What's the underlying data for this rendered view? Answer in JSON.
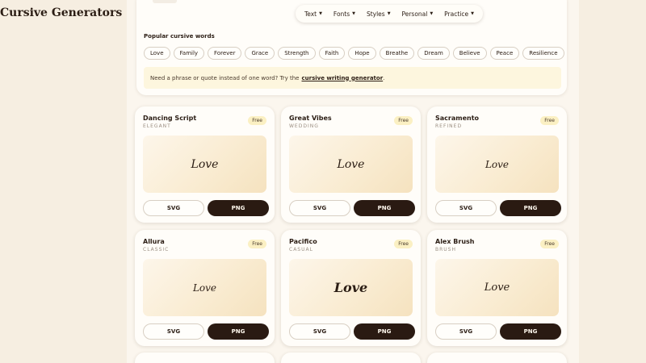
{
  "header": {
    "brand": "Cursive Generators",
    "nav": [
      {
        "label": "Text"
      },
      {
        "label": "Fonts"
      },
      {
        "label": "Styles"
      },
      {
        "label": "Personal"
      },
      {
        "label": "Practice"
      }
    ],
    "caret_glyph": "▼"
  },
  "popular": {
    "title": "Popular cursive words",
    "chips": [
      "Love",
      "Family",
      "Forever",
      "Grace",
      "Strength",
      "Faith",
      "Hope",
      "Breathe",
      "Dream",
      "Believe",
      "Peace",
      "Resilience"
    ]
  },
  "tip": {
    "text": "Need a phrase or quote instead of one word? Try the",
    "link": "cursive writing generator",
    "end": "."
  },
  "cards": [
    {
      "name": "Dancing Script",
      "style": "ELEGANT",
      "badge": "Free",
      "preview": "Love",
      "svg": "SVG",
      "png": "PNG"
    },
    {
      "name": "Great Vibes",
      "style": "WEDDING",
      "badge": "Free",
      "preview": "Love",
      "svg": "SVG",
      "png": "PNG"
    },
    {
      "name": "Sacramento",
      "style": "REFINED",
      "badge": "Free",
      "preview": "Love",
      "svg": "SVG",
      "png": "PNG"
    },
    {
      "name": "Allura",
      "style": "CLASSIC",
      "badge": "Free",
      "preview": "Love",
      "svg": "SVG",
      "png": "PNG"
    },
    {
      "name": "Pacifico",
      "style": "CASUAL",
      "badge": "Free",
      "preview": "Love",
      "svg": "SVG",
      "png": "PNG"
    },
    {
      "name": "Alex Brush",
      "style": "BRUSH",
      "badge": "Free",
      "preview": "Love",
      "svg": "SVG",
      "png": "PNG"
    }
  ],
  "colors": {
    "page_bg": "#f6eee1",
    "accent_dark": "#2a1a12",
    "badge_bg": "#fbf0c3",
    "tip_bg": "#fdf6de"
  }
}
